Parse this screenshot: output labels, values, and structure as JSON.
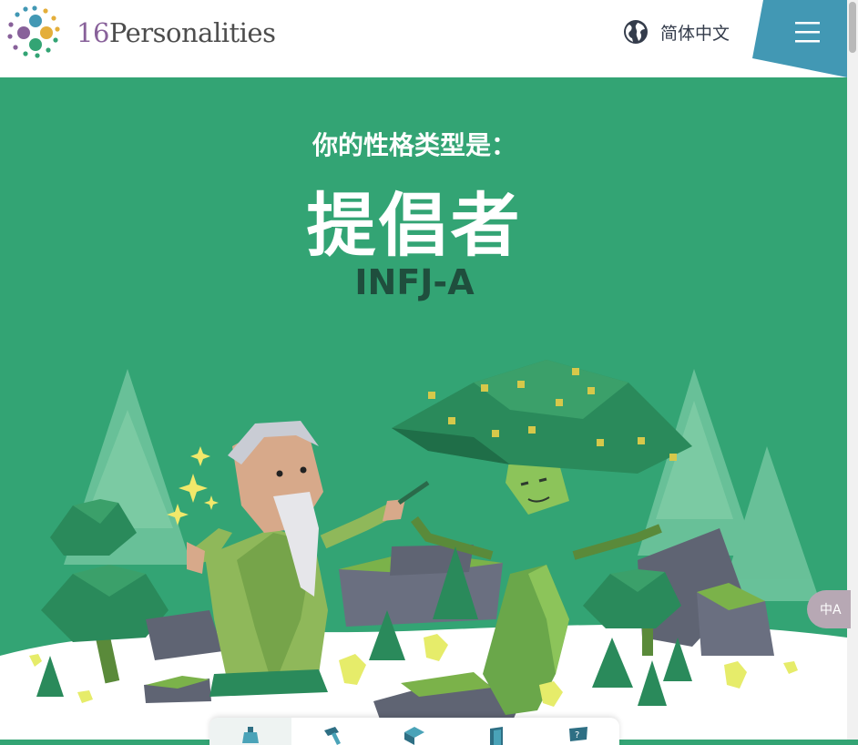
{
  "header": {
    "brand_num": "16",
    "brand_word": "Personalities",
    "language_label": "简体中文",
    "menu_color": "#4298b4"
  },
  "hero": {
    "subtitle": "你的性格类型是：",
    "type_name": "提倡者",
    "type_code": "INFJ-A",
    "background_color": "#33a474"
  },
  "tabs": [
    {
      "icon": "robot-icon"
    },
    {
      "icon": "hammer-icon"
    },
    {
      "icon": "box-icon"
    },
    {
      "icon": "book-icon"
    },
    {
      "icon": "sign-icon"
    }
  ]
}
